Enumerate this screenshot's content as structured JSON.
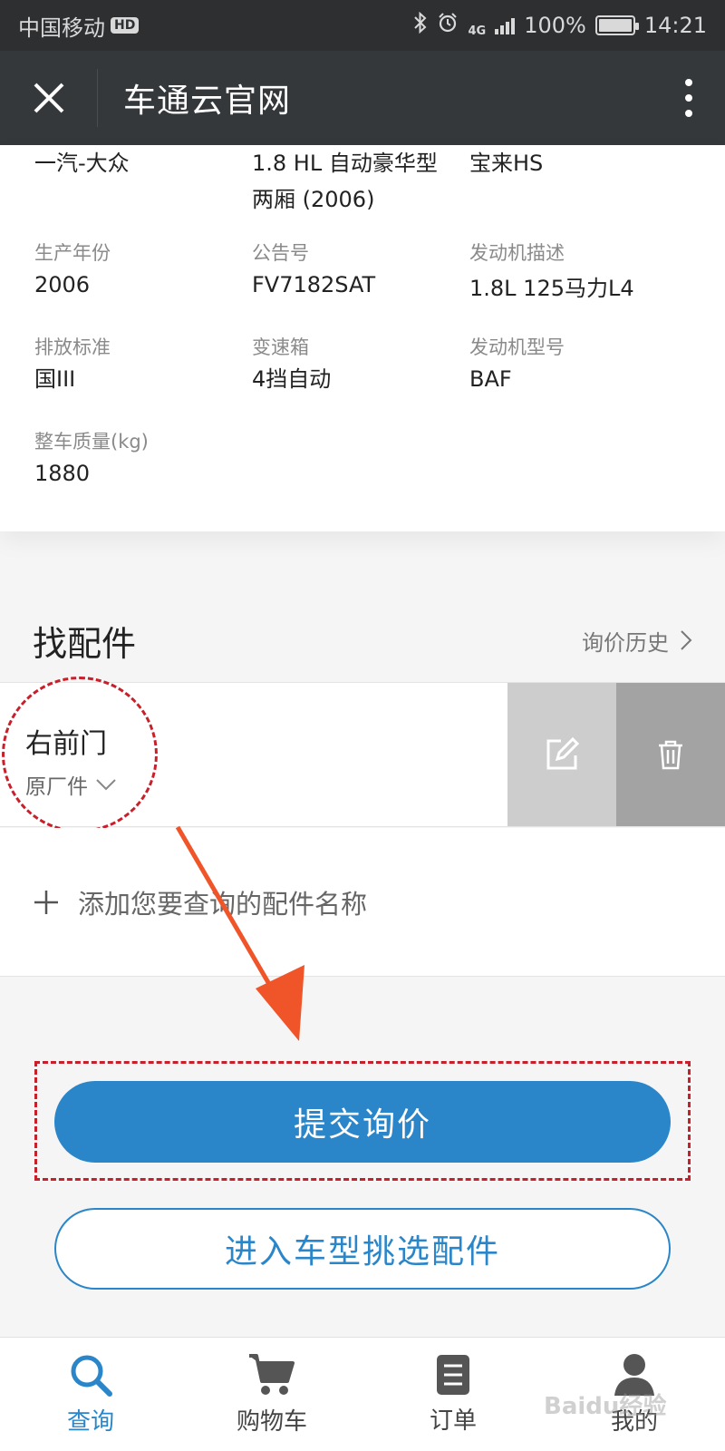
{
  "status_bar": {
    "carrier": "中国移动",
    "hd_badge": "HD",
    "network": "4G",
    "battery": "100%",
    "battery_level": 1.0,
    "time": "14:21"
  },
  "nav": {
    "title": "车通云官网"
  },
  "vehicle_info": {
    "row0": {
      "brand": "一汽-大众",
      "model": "1.8 HL 自动豪华型\n两厢 (2006)",
      "series": "宝来HS"
    },
    "fields": [
      {
        "label": "生产年份",
        "value": "2006"
      },
      {
        "label": "公告号",
        "value": "FV7182SAT"
      },
      {
        "label": "发动机描述",
        "value": "1.8L 125马力L4"
      },
      {
        "label": "排放标准",
        "value": "国III"
      },
      {
        "label": "变速箱",
        "value": "4挡自动"
      },
      {
        "label": "发动机型号",
        "value": "BAF"
      },
      {
        "label": "整车质量(kg)",
        "value": "1880"
      }
    ]
  },
  "parts_section": {
    "title": "找配件",
    "history_link": "询价历史",
    "part": {
      "name": "右前门",
      "type": "原厂件"
    },
    "add_placeholder": "添加您要查询的配件名称"
  },
  "buttons": {
    "submit": "提交询价",
    "browse": "进入车型挑选配件"
  },
  "tabs": [
    {
      "label": "查询",
      "icon": "search-icon",
      "active": true
    },
    {
      "label": "购物车",
      "icon": "cart-icon",
      "active": false
    },
    {
      "label": "订单",
      "icon": "order-icon",
      "active": false
    },
    {
      "label": "我的",
      "icon": "user-icon",
      "active": false
    }
  ],
  "watermark": "Baidu经验",
  "colors": {
    "accent": "#2a86c9",
    "annotation": "#c8202b",
    "arrow": "#f0552a",
    "navbar": "#35383b"
  }
}
